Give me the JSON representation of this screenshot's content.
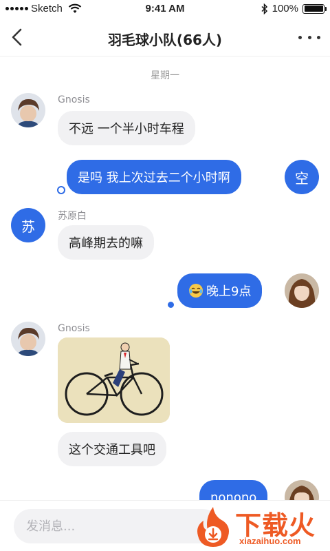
{
  "status_bar": {
    "carrier": "Sketch",
    "time": "9:41 AM",
    "battery": "100%",
    "battery_level": 1.0,
    "icons": [
      "signal-icon",
      "wifi-icon",
      "bluetooth-icon",
      "battery-icon"
    ]
  },
  "nav": {
    "title": "羽毛球小队(66人)",
    "icons": [
      "back-icon",
      "more-icon"
    ]
  },
  "chat": {
    "day_separator": "星期一",
    "messages": [
      {
        "sender": "Gnosis",
        "direction": "in",
        "text": "不远 一个半小时车程",
        "avatar": "photo"
      },
      {
        "sender": "",
        "direction": "out",
        "text": "是吗 我上次过去二个小时啊",
        "avatar_letter": "空"
      },
      {
        "sender": "苏原白",
        "direction": "in",
        "text": "高峰期去的嘛",
        "avatar_letter": "苏"
      },
      {
        "sender": "",
        "direction": "out",
        "text": "晚上9点",
        "emoji": "joy-emoji",
        "avatar": "photo"
      },
      {
        "sender": "Gnosis",
        "direction": "in",
        "image": "bicycle-illustration",
        "avatar": "photo"
      },
      {
        "sender": "Gnosis",
        "direction": "in",
        "text": "这个交通工具吧"
      },
      {
        "sender": "",
        "direction": "out",
        "text": "nonono",
        "avatar": "photo"
      }
    ]
  },
  "input": {
    "placeholder": "发消息..."
  },
  "watermark": {
    "brand": "下载火",
    "url": "xiazaihuo.com"
  },
  "colors": {
    "accent": "#2f6ce6",
    "bubble_in": "#f1f1f3",
    "watermark": "#ee5a24"
  }
}
